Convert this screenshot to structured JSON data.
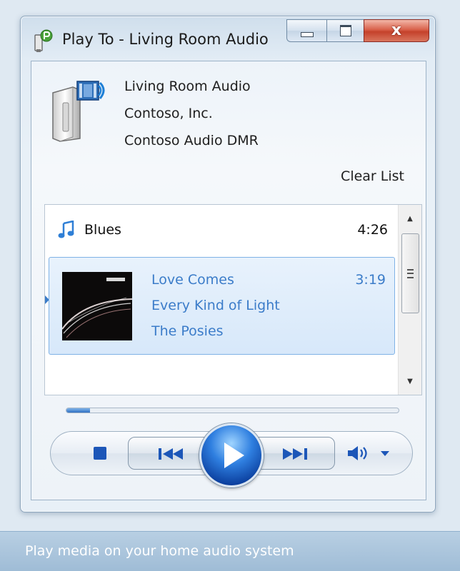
{
  "window": {
    "title": "Play To - Living Room Audio",
    "close_glyph": "x"
  },
  "device": {
    "name": "Living Room Audio",
    "manufacturer": "Contoso, Inc.",
    "model": "Contoso Audio DMR"
  },
  "actions": {
    "clear_list": "Clear List"
  },
  "playlist": {
    "title": "Blues",
    "duration": "4:26",
    "tracks": [
      {
        "title": "Love Comes",
        "album": "Every Kind of Light",
        "artist": "The Posies",
        "duration": "3:19"
      }
    ]
  },
  "playback": {
    "progress_fraction": 0.07
  },
  "icons": {
    "app": "play-to-icon",
    "device": "speaker-media-icon",
    "playlist": "music-note-icon",
    "stop": "stop-icon",
    "previous": "previous-track-icon",
    "play": "play-icon",
    "next": "next-track-icon",
    "volume": "speaker-icon"
  },
  "colors": {
    "accent_text": "#3b7cc9",
    "control_blue": "#1c56b8",
    "selection_bg": "#dbe9f9",
    "close_red": "#c4412a"
  },
  "statusbar": {
    "text": "Play media on your home audio system"
  }
}
